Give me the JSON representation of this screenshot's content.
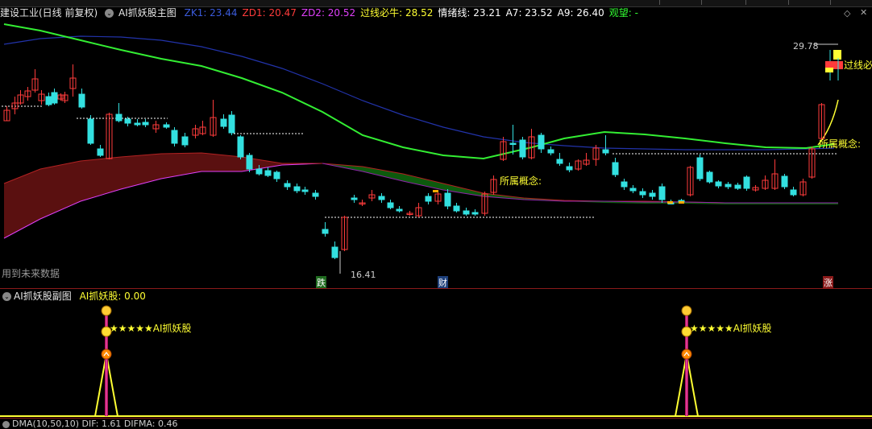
{
  "main_header": {
    "stock_name": "建设工业(日线 前复权)",
    "indicator_name": "AI抓妖股主图",
    "items": [
      {
        "label": "ZK1: 23.44",
        "color": "#3b5bdb"
      },
      {
        "label": "ZD1: 20.47",
        "color": "#ff3b3b"
      },
      {
        "label": "ZD2: 20.52",
        "color": "#e040fb"
      },
      {
        "label": "过线必牛: 28.52",
        "color": "#ffff33"
      },
      {
        "label": "情绪线: 23.21",
        "color": "#ffffff"
      },
      {
        "label": "A7: 23.52",
        "color": "#ffffff"
      },
      {
        "label": "A9: 26.40",
        "color": "#ffffff"
      },
      {
        "label": "观望: -",
        "color": "#33ff33"
      }
    ]
  },
  "main_chart": {
    "labels": {
      "high_price": "29.78",
      "low_price": "16.41",
      "future_data": "用到未来数据",
      "signal_guoxian": "过线必牛",
      "concept_1": "所属概念:",
      "concept_2": "所属概念:",
      "marker_die": "跌",
      "marker_cai": "财",
      "marker_zhang": "涨"
    }
  },
  "sub_header": {
    "indicator_name": "AI抓妖股副图",
    "value_label": "AI抓妖股: 0.00"
  },
  "sub_chart": {
    "signal_text_1": "★★★★★AI抓妖股",
    "signal_text_2": "★★★★★AI抓妖股"
  },
  "bottom_header": {
    "label": "DMA(10,50,10)  DIF: 1.61  DIFMA: 0.46"
  },
  "colors": {
    "up": "#ff3b3b",
    "down": "#33e0e0",
    "ma_green": "#33ee33",
    "ma_blue": "#2233aa",
    "cloud_red": "#5a1010",
    "cloud_green": "#0d5a0d",
    "yellow": "#ffff33"
  }
}
